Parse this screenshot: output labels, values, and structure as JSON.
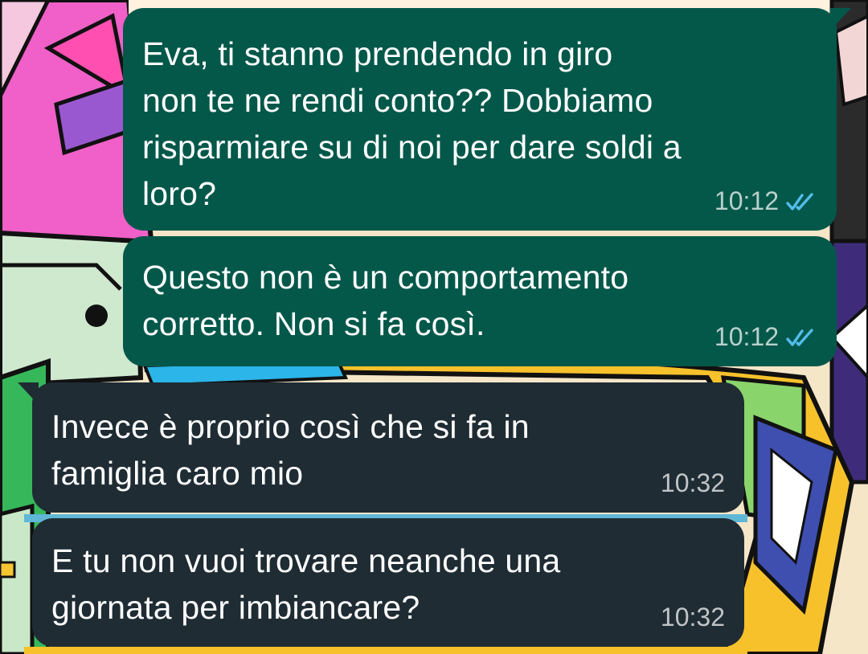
{
  "chat": {
    "messages": [
      {
        "direction": "outgoing",
        "text": "Eva, ti stanno prendendo in giro\nnon te ne rendi conto?? Dobbiamo\nrisparmiare su di noi per dare soldi a\nloro?",
        "time": "10:12",
        "status_icon": "double-check-read-icon"
      },
      {
        "direction": "outgoing",
        "text": "Questo non è un comportamento\ncorretto. Non si fa così.",
        "time": "10:12",
        "status_icon": "double-check-read-icon"
      },
      {
        "direction": "incoming",
        "text": "Invece è proprio così che si fa in\nfamiglia caro mio",
        "time": "10:32"
      },
      {
        "direction": "incoming",
        "text": "E tu non vuoi trovare neanche una\ngiornata per imbiancare?",
        "time": "10:32"
      }
    ],
    "colors": {
      "outgoing_bubble": "#04584a",
      "incoming_bubble": "#1f2c34",
      "read_ticks": "#53bdeb",
      "text": "#ffffff"
    }
  }
}
